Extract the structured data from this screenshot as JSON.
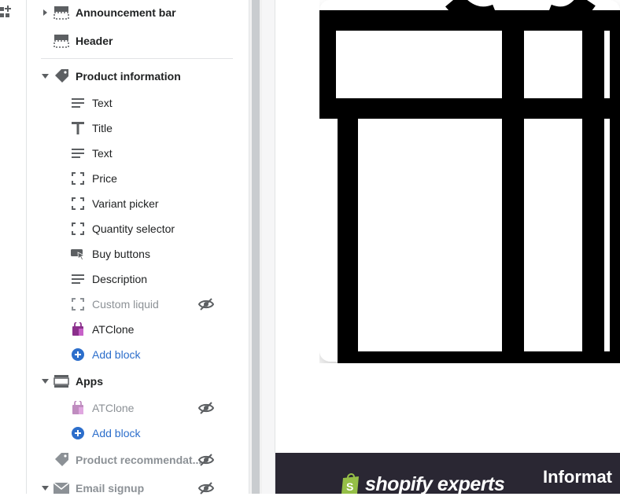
{
  "sidebar": {
    "sections": [
      {
        "key": "announcement",
        "label": "Announcement bar",
        "icon": "section-icon",
        "expanded": false
      },
      {
        "key": "header",
        "label": "Header",
        "icon": "section-icon"
      },
      {
        "key": "product_information",
        "label": "Product information",
        "icon": "tag-icon",
        "expanded": true,
        "blocks": [
          {
            "label": "Text",
            "icon": "text-lines-icon"
          },
          {
            "label": "Title",
            "icon": "title-T-icon"
          },
          {
            "label": "Text",
            "icon": "text-lines-icon"
          },
          {
            "label": "Price",
            "icon": "dashed-square-icon"
          },
          {
            "label": "Variant picker",
            "icon": "dashed-square-icon"
          },
          {
            "label": "Quantity selector",
            "icon": "dashed-square-icon"
          },
          {
            "label": "Buy buttons",
            "icon": "buy-button-icon"
          },
          {
            "label": "Description",
            "icon": "text-lines-icon"
          },
          {
            "label": "Custom liquid",
            "icon": "dashed-square-icon",
            "hidden": true
          },
          {
            "label": "ATClone",
            "icon": "atclone-bag-icon"
          }
        ],
        "add_block": "Add block"
      },
      {
        "key": "apps",
        "label": "Apps",
        "icon": "section-icon",
        "expanded": true,
        "blocks": [
          {
            "label": "ATClone",
            "icon": "atclone-bag-icon",
            "hidden": true
          }
        ],
        "add_block": "Add block"
      },
      {
        "key": "product_recommendations",
        "label": "Product recommendat...",
        "icon": "tag-icon",
        "hidden": true
      },
      {
        "key": "email_signup",
        "label": "Email signup",
        "icon": "envelope-icon",
        "hidden": true,
        "expanded": true
      }
    ]
  },
  "preview": {
    "footer_logo": "shopify experts",
    "footer_heading": "Informat"
  },
  "colors": {
    "accent": "#2c6ecb",
    "footer_bg": "#2a2733",
    "atclone": "#8b2f8c"
  }
}
